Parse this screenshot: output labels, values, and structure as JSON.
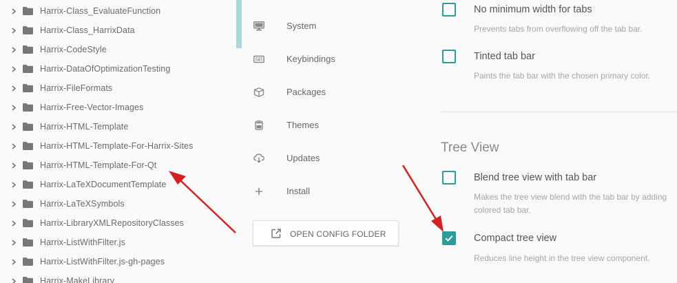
{
  "tree": {
    "items": [
      {
        "label": "Harrix-Class_EvaluateFunction"
      },
      {
        "label": "Harrix-Class_HarrixData"
      },
      {
        "label": "Harrix-CodeStyle"
      },
      {
        "label": "Harrix-DataOfOptimizationTesting"
      },
      {
        "label": "Harrix-FileFormats"
      },
      {
        "label": "Harrix-Free-Vector-Images"
      },
      {
        "label": "Harrix-HTML-Template"
      },
      {
        "label": "Harrix-HTML-Template-For-Harrix-Sites"
      },
      {
        "label": "Harrix-HTML-Template-For-Qt"
      },
      {
        "label": "Harrix-LaTeXDocumentTemplate"
      },
      {
        "label": "Harrix-LaTeXSymbols"
      },
      {
        "label": "Harrix-LibraryXMLRepositoryClasses"
      },
      {
        "label": "Harrix-ListWithFilter.js"
      },
      {
        "label": "Harrix-ListWithFilter.js-gh-pages"
      },
      {
        "label": "Harrix-MakeLibrary"
      }
    ]
  },
  "nav": {
    "items": [
      {
        "label": "System",
        "icon": "monitor-icon"
      },
      {
        "label": "Keybindings",
        "icon": "keyboard-icon"
      },
      {
        "label": "Packages",
        "icon": "package-icon"
      },
      {
        "label": "Themes",
        "icon": "paint-bucket-icon"
      },
      {
        "label": "Updates",
        "icon": "cloud-download-icon"
      },
      {
        "label": "Install",
        "icon": "plus-icon"
      }
    ],
    "open_config_label": "OPEN CONFIG FOLDER"
  },
  "settings": {
    "tabs_items": [
      {
        "title": "No minimum width for tabs",
        "desc": "Prevents tabs from overflowing off the tab bar.",
        "checked": false
      },
      {
        "title": "Tinted tab bar",
        "desc": "Paints the tab bar with the chosen primary color.",
        "checked": false
      }
    ],
    "tree_view_title": "Tree View",
    "tree_view_items": [
      {
        "title": "Blend tree view with tab bar",
        "desc_line1": "Makes the tree view blend with the tab bar by adding",
        "desc_line2": "colored tab bar.",
        "checked": false
      },
      {
        "title": "Compact tree view",
        "desc": "Reduces line height in the tree view component.",
        "checked": true
      }
    ]
  },
  "colors": {
    "accent": "#2a9d9a",
    "arrow": "#e02020",
    "scrollbar": "#a9d8d8"
  }
}
